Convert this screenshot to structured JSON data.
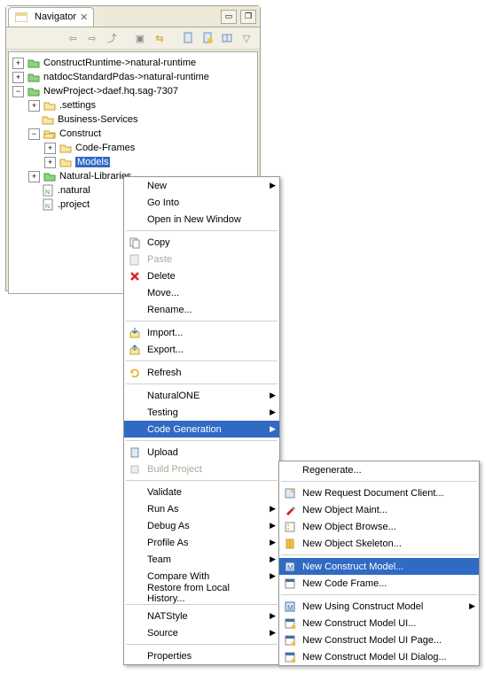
{
  "tab": {
    "title": "Navigator"
  },
  "tree": {
    "n0": "ConstructRuntime->natural-runtime",
    "n1": "natdocStandardPdas->natural-runtime",
    "n2": "NewProject->daef.hq.sag-7307",
    "n3": ".settings",
    "n4": "Business-Services",
    "n5": "Construct",
    "n6": "Code-Frames",
    "n7": "Models",
    "n8": "Natural-Libraries",
    "n9": ".natural",
    "n10": ".project"
  },
  "m1": {
    "new": "New",
    "gointo": "Go Into",
    "openwin": "Open in New Window",
    "copy": "Copy",
    "paste": "Paste",
    "delete": "Delete",
    "move": "Move...",
    "rename": "Rename...",
    "import": "Import...",
    "export": "Export...",
    "refresh": "Refresh",
    "natone": "NaturalONE",
    "testing": "Testing",
    "codegen": "Code Generation",
    "upload": "Upload",
    "build": "Build Project",
    "validate": "Validate",
    "runas": "Run As",
    "debugas": "Debug As",
    "profileas": "Profile As",
    "team": "Team",
    "compare": "Compare With",
    "restore": "Restore from Local History...",
    "natstyle": "NATStyle",
    "source": "Source",
    "props": "Properties"
  },
  "m2": {
    "regen": "Regenerate...",
    "reqdoc": "New Request Document Client...",
    "objmaint": "New Object Maint...",
    "objbrowse": "New Object Browse...",
    "objskel": "New Object Skeleton...",
    "constmodel": "New Construct Model...",
    "codeframe": "New Code Frame...",
    "usingconst": "New Using Construct Model",
    "constui": "New Construct Model UI...",
    "constuipage": "New Construct Model UI Page...",
    "constuidialog": "New Construct Model UI Dialog..."
  }
}
